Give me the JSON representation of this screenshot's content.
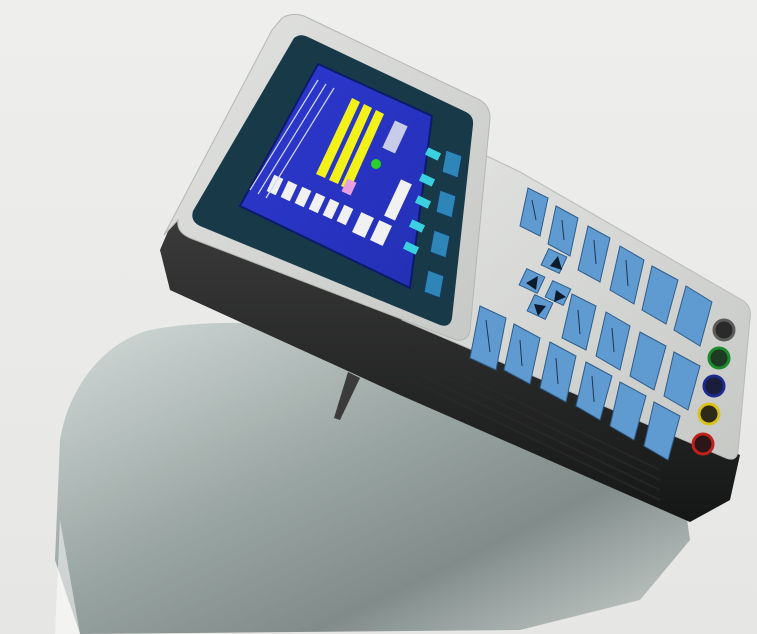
{
  "photo": {
    "subject": "handheld-power-analyzer",
    "screen_text": [],
    "key_labels": [],
    "terminal_colors": [
      "#1a1a1a",
      "#1b8a2a",
      "#1b2a8c",
      "#d9c21a",
      "#c0221b"
    ],
    "screen_bar_color": "#f2f21a",
    "screen_background": "#2a35c8",
    "keypad_color": "#5f9ad0"
  }
}
